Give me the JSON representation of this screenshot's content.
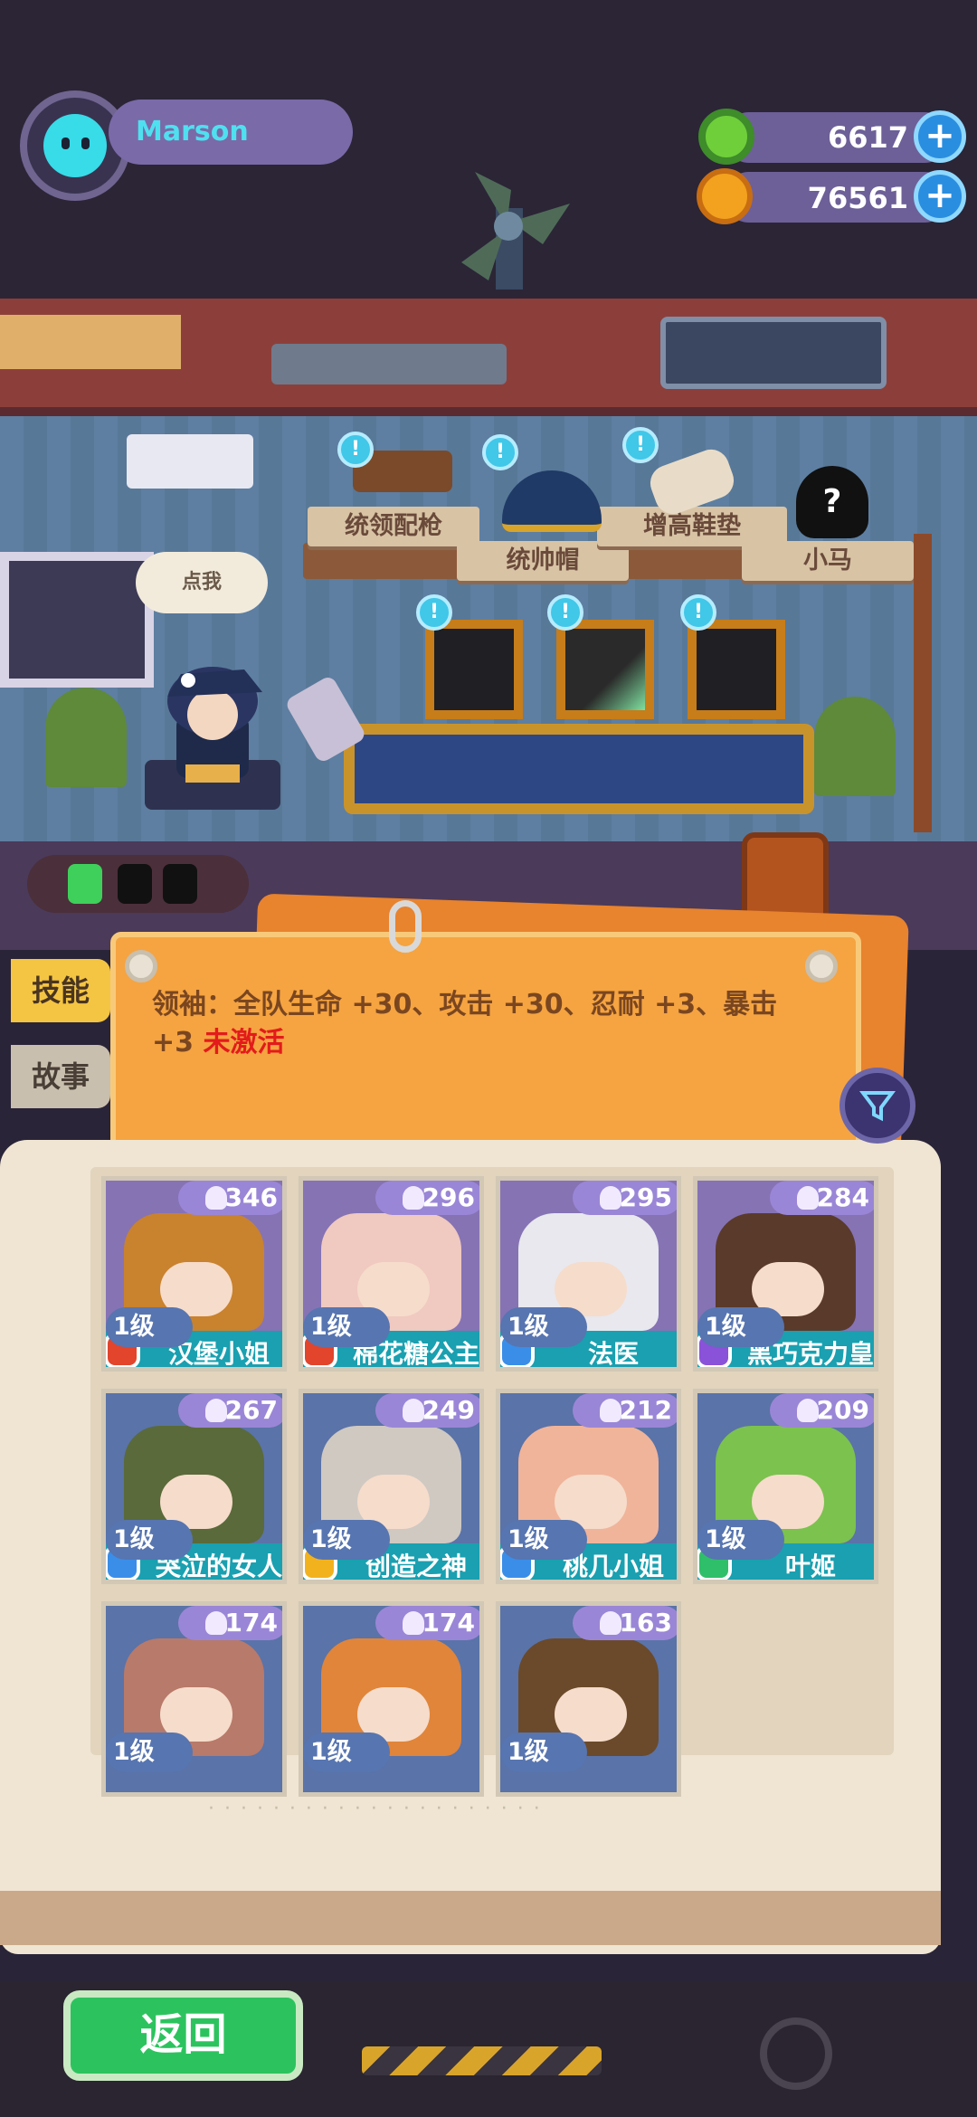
{
  "player": {
    "name": "Marson"
  },
  "currency": [
    {
      "icon": "green-donut-icon",
      "value": "6617",
      "color": "#6fcf3a"
    },
    {
      "icon": "gold-planet-icon",
      "value": "76561",
      "color": "#f2a21e"
    }
  ],
  "speech_bubble": "点我",
  "items_top": [
    {
      "label": "统领配枪"
    },
    {
      "label": "统帅帽"
    },
    {
      "label": "增高鞋垫"
    },
    {
      "label": "小马"
    }
  ],
  "alert_glyph": "!",
  "plus_glyph": "+",
  "side_tabs": {
    "skill": "技能",
    "story": "故事"
  },
  "skill": {
    "text": "领袖：全队生命 +30、攻击 +30、忍耐 +3、暴击 +3",
    "inactive": "未激活"
  },
  "characters": [
    {
      "count": "346",
      "level": "1级",
      "name": "汉堡小姐",
      "badge_color": "#e2442c",
      "portrait_color": "#c9822e"
    },
    {
      "count": "296",
      "level": "1级",
      "name": "棉花糖公主",
      "badge_color": "#e2442c",
      "portrait_color": "#f0c9c0"
    },
    {
      "count": "295",
      "level": "1级",
      "name": "法医",
      "badge_color": "#3a8ee8",
      "portrait_color": "#e8e8ee"
    },
    {
      "count": "284",
      "level": "1级",
      "name": "黑巧克力皇后",
      "badge_color": "#8a52d8",
      "portrait_color": "#5a3a2a"
    },
    {
      "count": "267",
      "level": "1级",
      "name": "哭泣的女人",
      "badge_color": "#3a8ee8",
      "portrait_color": "#5a6a3a"
    },
    {
      "count": "249",
      "level": "1级",
      "name": "创造之神",
      "badge_color": "#f2b21e",
      "portrait_color": "#cfc9c2"
    },
    {
      "count": "212",
      "level": "1级",
      "name": "桃几小姐",
      "badge_color": "#3a8ee8",
      "portrait_color": "#f0b49a"
    },
    {
      "count": "209",
      "level": "1级",
      "name": "叶姬",
      "badge_color": "#2fbf6a",
      "portrait_color": "#7cc24e"
    },
    {
      "count": "174",
      "level": "1级",
      "name": "",
      "badge_color": "",
      "portrait_color": "#b87a6a"
    },
    {
      "count": "174",
      "level": "1级",
      "name": "",
      "badge_color": "",
      "portrait_color": "#e0853a"
    },
    {
      "count": "163",
      "level": "1级",
      "name": "",
      "badge_color": "",
      "portrait_color": "#6a4a2a"
    }
  ],
  "buttons": {
    "back": "返回"
  }
}
